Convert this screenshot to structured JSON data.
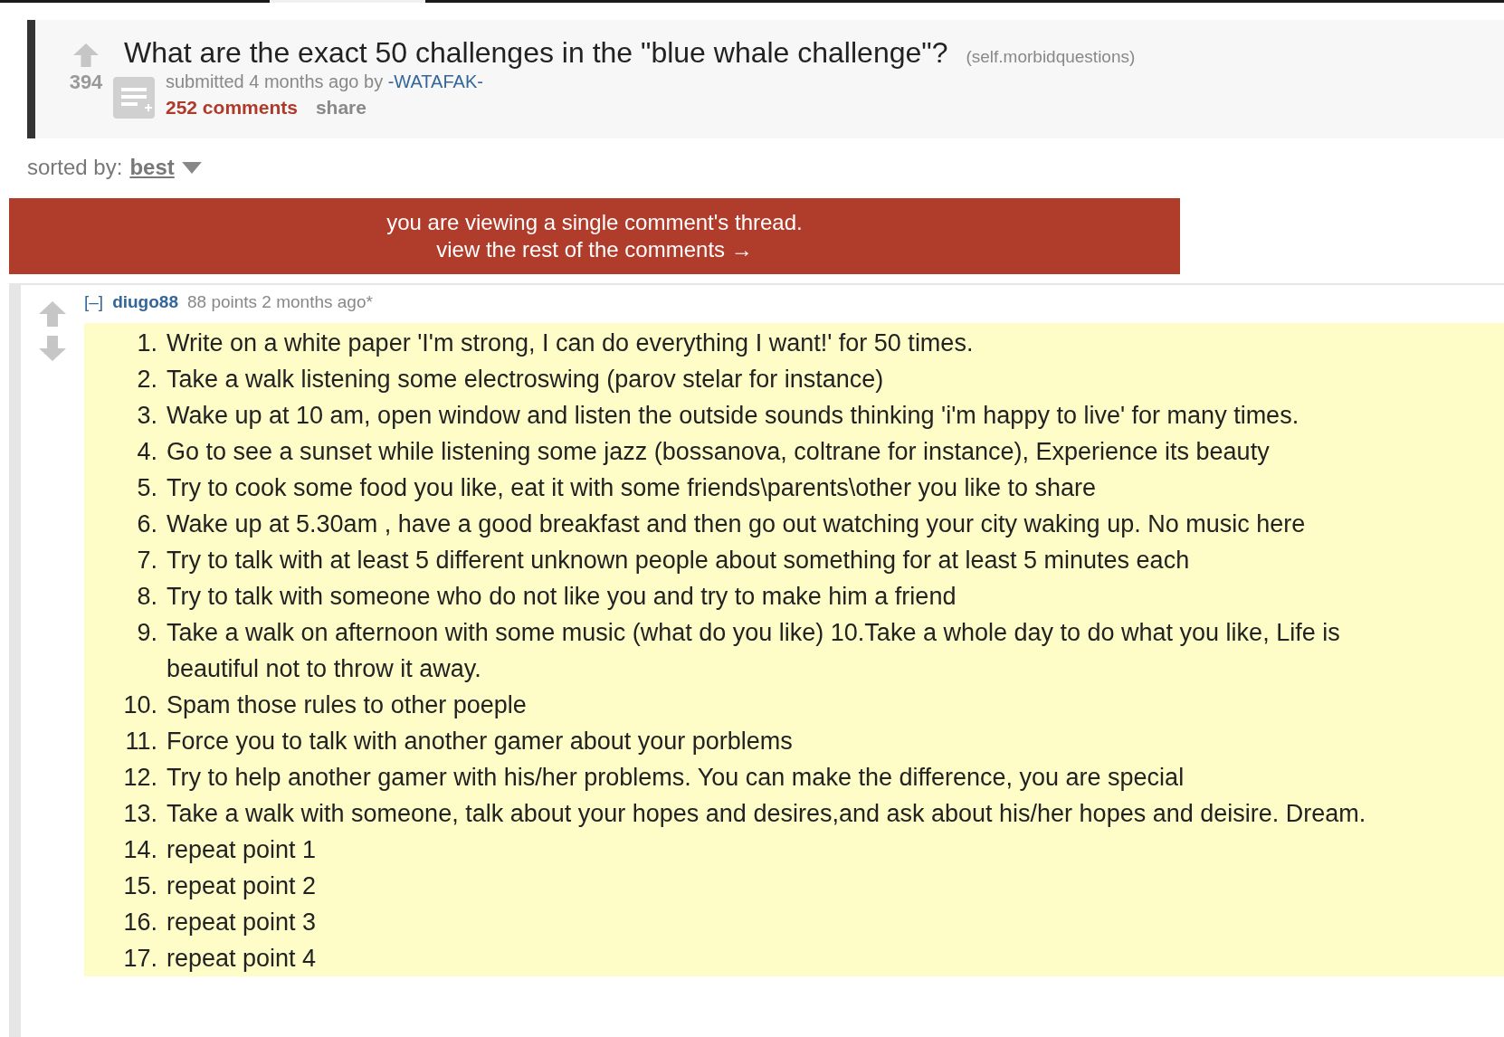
{
  "post": {
    "score": "394",
    "title": "What are the exact 50 challenges in the \"blue whale challenge\"?",
    "domain": "(self.morbidquestions)",
    "submitted": "submitted 4 months ago by",
    "author": "-WATAFAK-",
    "comments_link": "252 comments",
    "share_link": "share"
  },
  "sort": {
    "label": "sorted by:",
    "value": "best"
  },
  "banner": {
    "line1": "you are viewing a single comment's thread.",
    "line2": "view the rest of the comments →"
  },
  "comment": {
    "collapse": "[–]",
    "author": "diugo88",
    "meta": "88 points 2 months ago*",
    "items": [
      {
        "number": "1.",
        "text": "Write on a white paper 'I'm strong, I can do everything I want!' for 50 times."
      },
      {
        "number": "2.",
        "text": "Take a walk listening some electroswing (parov stelar for instance)"
      },
      {
        "number": "3.",
        "text": "Wake up at 10 am, open window and listen the outside sounds thinking 'i'm happy to live' for many times."
      },
      {
        "number": "4.",
        "text": "Go to see a sunset while listening some jazz (bossanova, coltrane for instance), Experience its beauty"
      },
      {
        "number": "5.",
        "text": "Try to cook some food you like, eat it with some friends\\parents\\other you like to share"
      },
      {
        "number": "6.",
        "text": "Wake up at 5.30am , have a good breakfast and then go out watching your city waking up. No music here"
      },
      {
        "number": "7.",
        "text": "Try to talk with at least 5 different unknown people about something for at least 5 minutes each"
      },
      {
        "number": "8.",
        "text": "Try to talk with someone who do not like you and try to make him a friend"
      },
      {
        "number": "9.",
        "text": "Take a walk on afternoon with some music (what do you like) 10.Take a whole day to do what you like, Life is beautiful not to throw it away."
      },
      {
        "number": "10.",
        "text": "Spam those rules to other poeple"
      },
      {
        "number": "11.",
        "text": "Force you to talk with another gamer about your porblems"
      },
      {
        "number": "12.",
        "text": "Try to help another gamer with his/her problems. You can make the difference, you are special"
      },
      {
        "number": "13.",
        "text": "Take a walk with someone, talk about your hopes and desires,and ask about his/her hopes and deisire. Dream."
      },
      {
        "number": "14.",
        "text": "repeat point 1"
      },
      {
        "number": "15.",
        "text": "repeat point 2"
      },
      {
        "number": "16.",
        "text": "repeat point 3"
      },
      {
        "number": "17.",
        "text": "repeat point 4"
      }
    ]
  }
}
